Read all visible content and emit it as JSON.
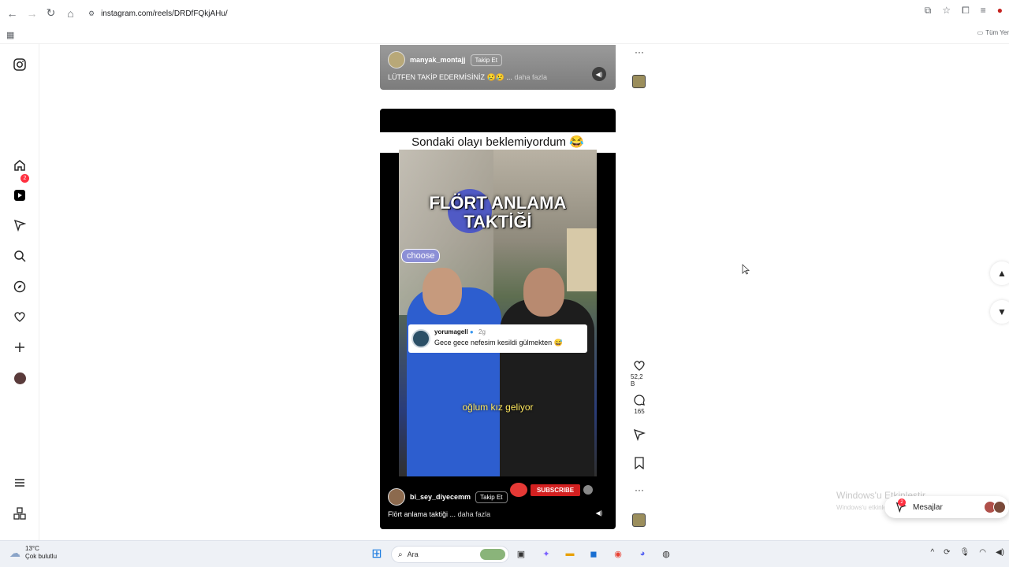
{
  "browser": {
    "url": "instagram.com/reels/DRDfFQkjAHu/",
    "all_bookmarks": "Tüm Yer"
  },
  "sidebar": {
    "items": [
      {
        "name": "instagram-logo-icon"
      },
      {
        "name": "home-icon"
      },
      {
        "name": "reels-icon"
      },
      {
        "name": "messages-icon"
      },
      {
        "name": "search-icon"
      },
      {
        "name": "explore-icon"
      },
      {
        "name": "notifications-icon"
      },
      {
        "name": "create-icon"
      },
      {
        "name": "profile-avatar"
      },
      {
        "name": "menu-icon"
      },
      {
        "name": "more-apps-icon"
      }
    ],
    "messages_badge": "2"
  },
  "reel_previous": {
    "username": "manyak_montajj",
    "follow": "Takip Et",
    "caption": "LÜTFEN TAKİP EDERMİSİNİZ 😢😢 ...",
    "more": "daha fazla"
  },
  "reel_current": {
    "heading": "Sondaki olayı beklemiyordum 😂",
    "overlay_title_line1": "FLÖRT ANLAMA",
    "overlay_title_line2": "TAKTİĞİ",
    "tag": "choose",
    "comment": {
      "user": "yorumagell",
      "time": "2g",
      "text": "Gece gece nefesim kesildi gülmekten 😅"
    },
    "subtitle": "oğlum kız geliyor",
    "subscribe": "SUBSCRIBE",
    "username": "bi_sey_diyecemm",
    "follow": "Takip Et",
    "caption": "Flört anlama taktiği ...",
    "more": "daha fazla"
  },
  "actions": {
    "likes": "52,2 B",
    "comments": "165"
  },
  "watermark": {
    "title": "Windows'u Etkinleştir",
    "subtitle": "Windows'u etkinleştirmek için Ayarlar'a gidin."
  },
  "messages_pill": {
    "label": "Mesajlar",
    "badge": "2"
  },
  "taskbar": {
    "temperature": "13°C",
    "weather": "Çok bulutlu",
    "search_placeholder": "Ara"
  },
  "colors": {
    "badge_red": "#ff3040",
    "subscribe_red": "#d32020",
    "taskbar_bg": "#eef1f6"
  }
}
